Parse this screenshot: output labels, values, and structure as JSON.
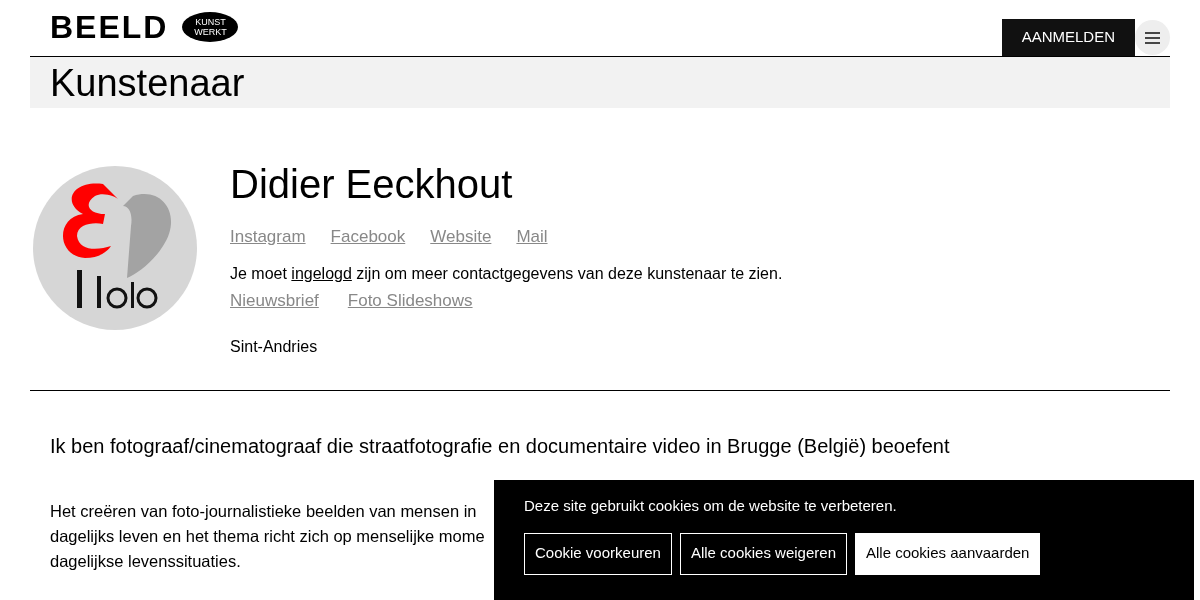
{
  "header": {
    "logo": "BEELD",
    "badge": [
      "KUNST",
      "WERKT"
    ],
    "login_button": "AANMELDEN"
  },
  "page_title": "Kunstenaar",
  "artist": {
    "name": "Didier Eeckhout",
    "avatar": {
      "kind": "picture"
    },
    "links": [
      "Instagram",
      "Facebook",
      "Website",
      "Mail"
    ],
    "login_note": {
      "before": "Je moet ",
      "link": "ingelogd",
      "after": " zijn om meer contactgegevens van deze kunstenaar te zien."
    },
    "extra_links": [
      "Nieuwsbrief",
      "Foto Slideshows"
    ],
    "location": "Sint-Andries"
  },
  "intro": "Ik ben fotograaf/cinematograaf die straatfotografie en documentaire video in Brugge (België) beoefent",
  "body_lines": [
    "Het creëren van foto-journalistieke beelden van mensen in",
    "dagelijks leven en het thema richt zich op menselijke mome",
    "dagelijkse levenssituaties."
  ],
  "cookie_banner": {
    "message": "Deze site gebruikt cookies om de website te verbeteren.",
    "buttons": [
      {
        "label": "Cookie voorkeuren",
        "kind": "outline"
      },
      {
        "label": "Alle cookies weigeren",
        "kind": "outline"
      },
      {
        "label": "Alle cookies aanvaarden",
        "kind": "solid"
      }
    ]
  }
}
